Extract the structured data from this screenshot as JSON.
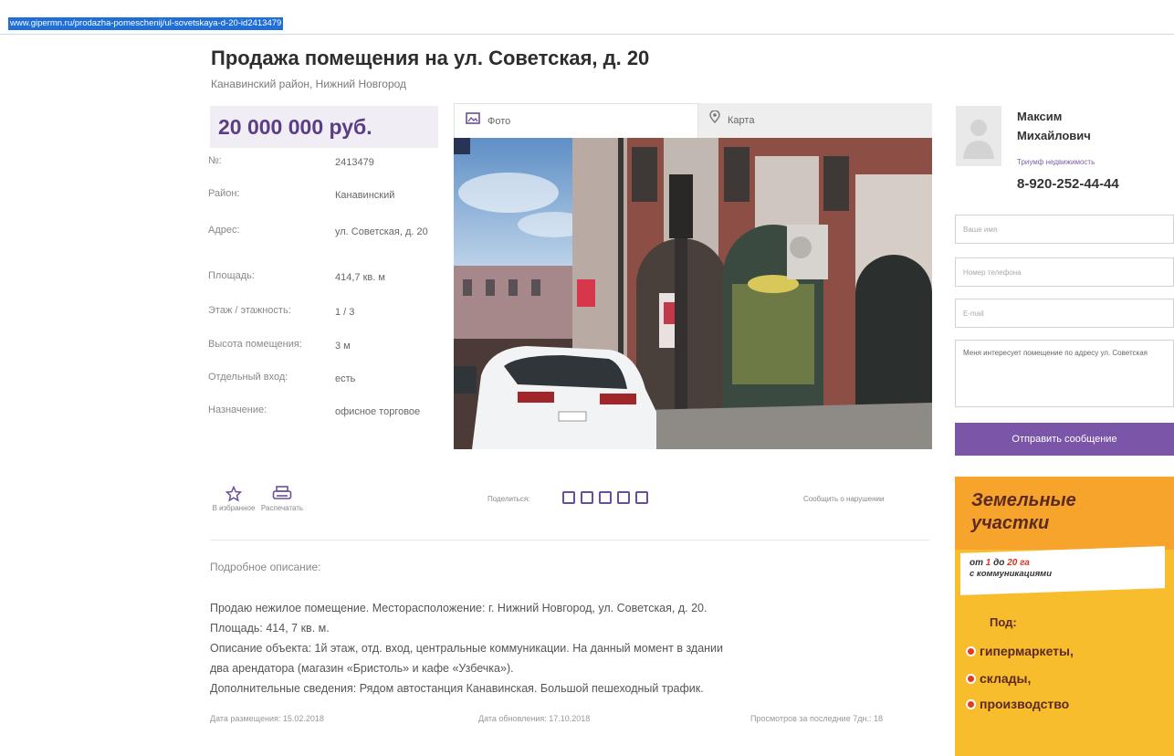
{
  "page": {
    "url": "www.gipermn.ru/prodazha-pomeschenij/ul-sovetskaya-d-20-id2413479",
    "title": "Продажа помещения на ул. Советская, д. 20",
    "subtitle": "Канавинский район, Нижний Новгород"
  },
  "listing": {
    "price": "20 000 000 руб.",
    "params": [
      {
        "label": "№:",
        "value": "2413479"
      },
      {
        "label": "Район:",
        "value": "Канавинский"
      },
      {
        "label": "Адрес:",
        "value": "ул. Советская, д. 20"
      },
      {
        "label": "Площадь:",
        "value": "414,7 кв. м"
      },
      {
        "label": "Этаж / этажность:",
        "value": "1 / 3"
      },
      {
        "label": "Высота помещения:",
        "value": "3 м"
      },
      {
        "label": "Отдельный вход:",
        "value": "есть"
      },
      {
        "label": "Назначение:",
        "value": "офисное торговое"
      }
    ]
  },
  "tabs": {
    "photo": "Фото",
    "map": "Карта"
  },
  "actions": {
    "favorite": "В избранное",
    "print": "Распечатать",
    "share": "Поделиться:",
    "report": "Сообщить о нарушении"
  },
  "description": {
    "title": "Подробное описание:",
    "lines": [
      "Продаю нежилое помещение. Месторасположение: г. Нижний Новгород, ул. Советская, д. 20.",
      "Площадь: 414, 7 кв. м.",
      "Описание объекта: 1й этаж, отд. вход, центральные коммуникации. На данный момент в здании",
      "два арендатора (магазин «Бристоль» и кафе «Узбечка»).",
      "Дополнительные сведения: Рядом автостанция Канавинская. Большой пешеходный трафик."
    ]
  },
  "footer": {
    "posted": "Дата размещения: 15.02.2018",
    "updated": "Дата обновления: 17.10.2018",
    "views": "Просмотров за последние 7дн.: 18"
  },
  "agent": {
    "name": "Максим Михайлович",
    "company": "Триумф недвижимость",
    "phone": "8-920-252-44-44"
  },
  "form": {
    "name_placeholder": "Ваше имя",
    "phone_placeholder": "Номер телефона",
    "email_placeholder": "E-mail",
    "message": "Меня интересует помещение по адресу ул. Советская",
    "send": "Отправить сообщение"
  },
  "banner": {
    "title_line1": "Земельные",
    "title_line2": "участки",
    "range_from": "от ",
    "range_n1": "1",
    "range_mid": " до ",
    "range_n2": "20 га",
    "range_line2": "с коммуникациями",
    "for": "Под:",
    "items": [
      "гипермаркеты,",
      "склады,",
      "производство"
    ]
  },
  "colors": {
    "accent": "#7b55a8",
    "price": "#5b3d86",
    "banner_bg": "#f8bd2c",
    "banner_text": "#5a2a23"
  }
}
